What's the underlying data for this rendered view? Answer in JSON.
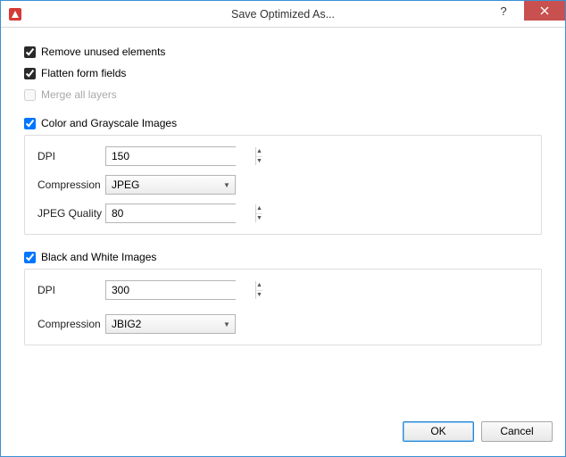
{
  "window": {
    "title": "Save Optimized As..."
  },
  "options": {
    "remove_unused": {
      "label": "Remove unused elements",
      "checked": true,
      "enabled": true
    },
    "flatten_fields": {
      "label": "Flatten form fields",
      "checked": true,
      "enabled": true
    },
    "merge_layers": {
      "label": "Merge all layers",
      "checked": false,
      "enabled": false
    }
  },
  "color_images": {
    "enabled": true,
    "title": "Color and Grayscale Images",
    "dpi": {
      "label": "DPI",
      "value": "150"
    },
    "compression": {
      "label": "Compression",
      "value": "JPEG"
    },
    "jpeg_quality": {
      "label": "JPEG Quality",
      "value": "80"
    }
  },
  "bw_images": {
    "enabled": true,
    "title": "Black and White Images",
    "dpi": {
      "label": "DPI",
      "value": "300"
    },
    "compression": {
      "label": "Compression",
      "value": "JBIG2"
    }
  },
  "buttons": {
    "ok": "OK",
    "cancel": "Cancel"
  }
}
